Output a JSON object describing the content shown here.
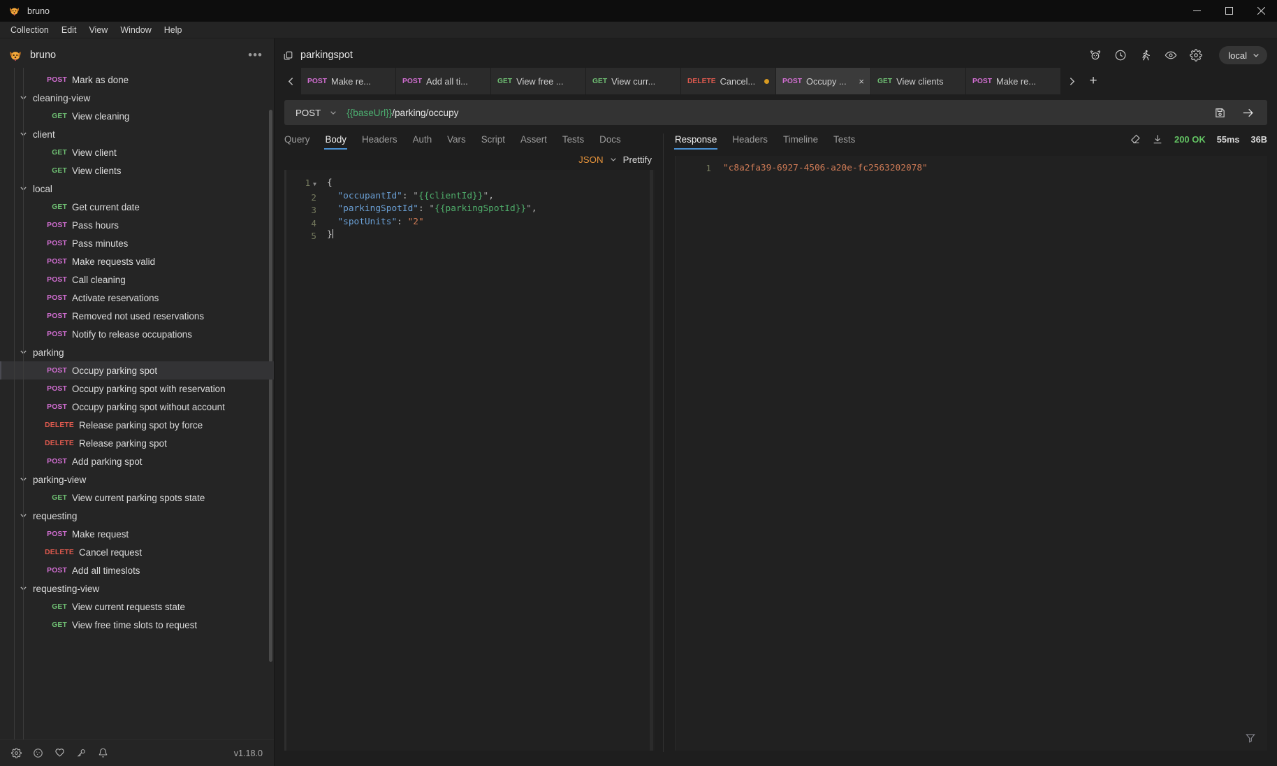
{
  "window": {
    "title": "bruno",
    "controls": {
      "minimize": "minimize-icon",
      "maximize": "maximize-icon",
      "close": "close-icon"
    }
  },
  "menubar": {
    "items": [
      "Collection",
      "Edit",
      "View",
      "Window",
      "Help"
    ]
  },
  "sidebar": {
    "collection_name": "bruno",
    "overflow_label": "•••",
    "version": "v1.18.0",
    "footer_icons": [
      "gear-icon",
      "cookie-icon",
      "heart-icon",
      "key-icon",
      "bell-icon"
    ],
    "tree": [
      {
        "type": "request",
        "method": "POST",
        "label": "Mark as done",
        "depth": 2
      },
      {
        "type": "folder",
        "label": "cleaning-view",
        "depth": 1
      },
      {
        "type": "request",
        "method": "GET",
        "label": "View cleaning",
        "depth": 2
      },
      {
        "type": "folder",
        "label": "client",
        "depth": 1
      },
      {
        "type": "request",
        "method": "GET",
        "label": "View client",
        "depth": 2
      },
      {
        "type": "request",
        "method": "GET",
        "label": "View clients",
        "depth": 2
      },
      {
        "type": "folder",
        "label": "local",
        "depth": 1
      },
      {
        "type": "request",
        "method": "GET",
        "label": "Get current date",
        "depth": 2
      },
      {
        "type": "request",
        "method": "POST",
        "label": "Pass hours",
        "depth": 2
      },
      {
        "type": "request",
        "method": "POST",
        "label": "Pass minutes",
        "depth": 2
      },
      {
        "type": "request",
        "method": "POST",
        "label": "Make requests valid",
        "depth": 2
      },
      {
        "type": "request",
        "method": "POST",
        "label": "Call cleaning",
        "depth": 2
      },
      {
        "type": "request",
        "method": "POST",
        "label": "Activate reservations",
        "depth": 2
      },
      {
        "type": "request",
        "method": "POST",
        "label": "Removed not used reservations",
        "depth": 2
      },
      {
        "type": "request",
        "method": "POST",
        "label": "Notify to release occupations",
        "depth": 2
      },
      {
        "type": "folder",
        "label": "parking",
        "depth": 1
      },
      {
        "type": "request",
        "method": "POST",
        "label": "Occupy parking spot",
        "depth": 2,
        "selected": true
      },
      {
        "type": "request",
        "method": "POST",
        "label": "Occupy parking spot with reservation",
        "depth": 2
      },
      {
        "type": "request",
        "method": "POST",
        "label": "Occupy parking spot without account",
        "depth": 2
      },
      {
        "type": "request",
        "method": "DELETE",
        "label": "Release parking spot by force",
        "depth": 2
      },
      {
        "type": "request",
        "method": "DELETE",
        "label": "Release parking spot",
        "depth": 2
      },
      {
        "type": "request",
        "method": "POST",
        "label": "Add parking spot",
        "depth": 2
      },
      {
        "type": "folder",
        "label": "parking-view",
        "depth": 1
      },
      {
        "type": "request",
        "method": "GET",
        "label": "View current parking spots state",
        "depth": 2
      },
      {
        "type": "folder",
        "label": "requesting",
        "depth": 1
      },
      {
        "type": "request",
        "method": "POST",
        "label": "Make request",
        "depth": 2
      },
      {
        "type": "request",
        "method": "DELETE",
        "label": "Cancel request",
        "depth": 2
      },
      {
        "type": "request",
        "method": "POST",
        "label": "Add all timeslots",
        "depth": 2
      },
      {
        "type": "folder",
        "label": "requesting-view",
        "depth": 1
      },
      {
        "type": "request",
        "method": "GET",
        "label": "View current requests state",
        "depth": 2
      },
      {
        "type": "request",
        "method": "GET",
        "label": "View free time slots to request",
        "depth": 2
      }
    ]
  },
  "main_header": {
    "title": "parkingspot",
    "icon": "copy-icon",
    "toolbar_icons": [
      "bruno-dog-icon",
      "history-clock-icon",
      "runner-icon",
      "eye-icon",
      "gear-icon"
    ],
    "environment": "local"
  },
  "tabstrip": {
    "prev_label": "‹",
    "next_label": "›",
    "add_label": "+",
    "tabs": [
      {
        "method": "POST",
        "label": "Make re...",
        "active": false,
        "dirty": false
      },
      {
        "method": "POST",
        "label": "Add all ti...",
        "active": false,
        "dirty": false
      },
      {
        "method": "GET",
        "label": "View free ...",
        "active": false,
        "dirty": false
      },
      {
        "method": "GET",
        "label": "View curr...",
        "active": false,
        "dirty": false
      },
      {
        "method": "DELETE",
        "label": "Cancel...",
        "active": false,
        "dirty": true
      },
      {
        "method": "POST",
        "label": "Occupy ...",
        "active": true,
        "dirty": false,
        "close": "×"
      },
      {
        "method": "GET",
        "label": "View clients",
        "active": false,
        "dirty": false
      },
      {
        "method": "POST",
        "label": "Make re...",
        "active": false,
        "dirty": false
      }
    ]
  },
  "urlbar": {
    "method": "POST",
    "url_variable": "{{baseUrl}}",
    "url_path": "/parking/occupy",
    "save_icon": "save-floppy-icon",
    "send_icon": "send-arrow-icon"
  },
  "request_panel": {
    "tabs": [
      {
        "label": "Query",
        "active": false
      },
      {
        "label": "Body",
        "active": true
      },
      {
        "label": "Headers",
        "active": false
      },
      {
        "label": "Auth",
        "active": false
      },
      {
        "label": "Vars",
        "active": false
      },
      {
        "label": "Script",
        "active": false
      },
      {
        "label": "Assert",
        "active": false
      },
      {
        "label": "Tests",
        "active": false
      },
      {
        "label": "Docs",
        "active": false
      }
    ],
    "body_format": "JSON",
    "prettify_label": "Prettify",
    "editor": {
      "line_numbers": [
        "1",
        "2",
        "3",
        "4",
        "5"
      ],
      "lines": [
        {
          "n": "1",
          "fold": true,
          "tokens": [
            {
              "t": "brace",
              "v": "{"
            }
          ]
        },
        {
          "n": "2",
          "tokens": [
            {
              "t": "plain",
              "v": "  "
            },
            {
              "t": "key",
              "v": "\"occupantId\""
            },
            {
              "t": "punct",
              "v": ": "
            },
            {
              "t": "quote",
              "v": "\""
            },
            {
              "t": "var",
              "v": "{{clientId}}"
            },
            {
              "t": "quote",
              "v": "\""
            },
            {
              "t": "punct",
              "v": ","
            }
          ]
        },
        {
          "n": "3",
          "tokens": [
            {
              "t": "plain",
              "v": "  "
            },
            {
              "t": "key",
              "v": "\"parkingSpotId\""
            },
            {
              "t": "punct",
              "v": ": "
            },
            {
              "t": "quote",
              "v": "\""
            },
            {
              "t": "var",
              "v": "{{parkingSpotId}}"
            },
            {
              "t": "quote",
              "v": "\""
            },
            {
              "t": "punct",
              "v": ","
            }
          ]
        },
        {
          "n": "4",
          "tokens": [
            {
              "t": "plain",
              "v": "  "
            },
            {
              "t": "key",
              "v": "\"spotUnits\""
            },
            {
              "t": "punct",
              "v": ": "
            },
            {
              "t": "str",
              "v": "\"2\""
            }
          ]
        },
        {
          "n": "5",
          "tokens": [
            {
              "t": "brace",
              "v": "}"
            }
          ]
        }
      ]
    }
  },
  "response_panel": {
    "tabs": [
      {
        "label": "Response",
        "active": true
      },
      {
        "label": "Headers",
        "active": false
      },
      {
        "label": "Timeline",
        "active": false
      },
      {
        "label": "Tests",
        "active": false
      }
    ],
    "clear_icon": "eraser-icon",
    "download_icon": "download-icon",
    "status": "200 OK",
    "status_color": "#63c363",
    "time": "55ms",
    "size": "36B",
    "filter_icon": "filter-funnel-icon",
    "body": {
      "line_number": "1",
      "value": "\"c8a2fa39-6927-4506-a20e-fc2563202078\""
    }
  }
}
